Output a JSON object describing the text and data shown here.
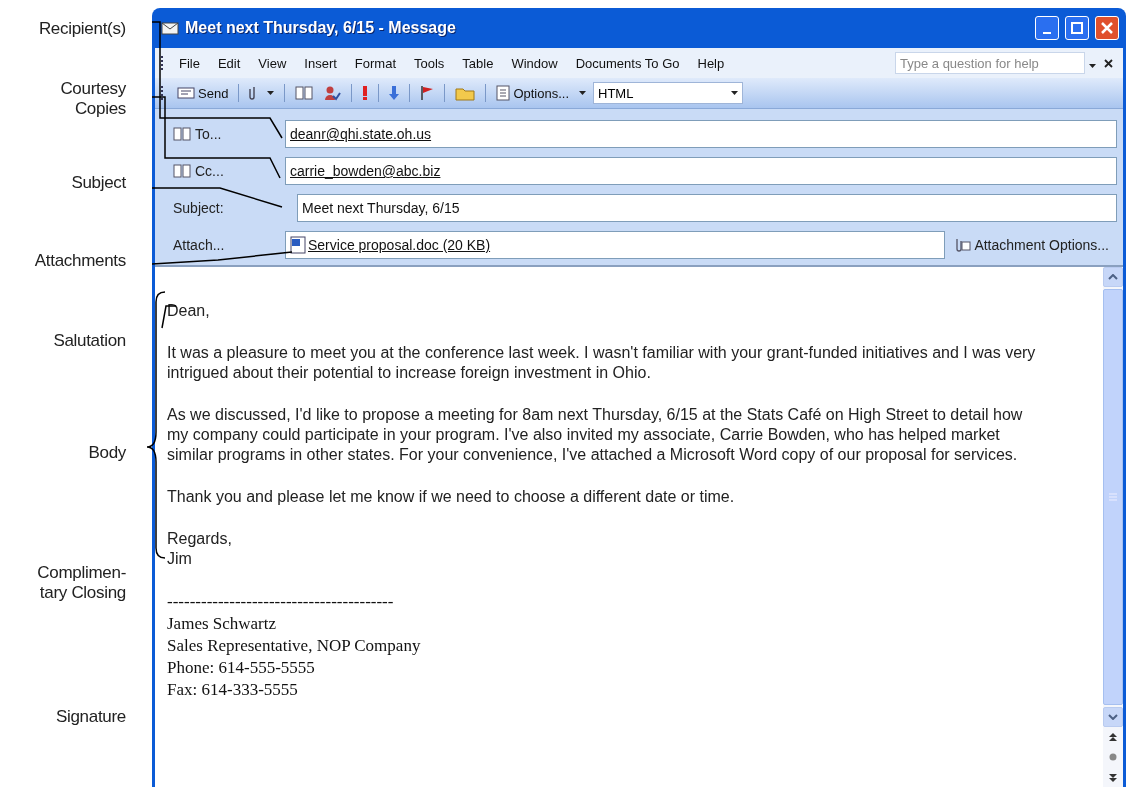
{
  "annotations": [
    {
      "kind": "line",
      "lines": [
        "Recipient(s)"
      ]
    },
    {
      "kind": "line",
      "lines": [
        "Courtesy",
        "Copies"
      ]
    },
    {
      "kind": "line",
      "lines": [
        "Subject"
      ]
    },
    {
      "kind": "line",
      "lines": [
        "Attachments"
      ]
    },
    {
      "kind": "line",
      "lines": [
        "Salutation"
      ]
    },
    {
      "kind": "brace",
      "lines": [
        "Body"
      ]
    },
    {
      "kind": "none",
      "lines": [
        "Complimen-",
        "tary Closing"
      ]
    },
    {
      "kind": "none",
      "lines": [
        "Signature"
      ]
    }
  ],
  "window": {
    "title": "Meet next Thursday, 6/15 - Message"
  },
  "menu": [
    "File",
    "Edit",
    "View",
    "Insert",
    "Format",
    "Tools",
    "Table",
    "Window",
    "Documents To Go",
    "Help"
  ],
  "help_box": {
    "placeholder": "Type a question for help"
  },
  "toolbar": {
    "send": "Send",
    "options": "Options...",
    "format": "HTML"
  },
  "fields": [
    {
      "kind": "address",
      "label": "To...",
      "value": "deanr@qhi.state.oh.us"
    },
    {
      "kind": "address",
      "label": "Cc...",
      "value": "carrie_bowden@abc.biz"
    },
    {
      "kind": "plain",
      "label": "Subject:",
      "value": "Meet next Thursday, 6/15"
    }
  ],
  "attachment": {
    "label": "Attach...",
    "file": "Service proposal.doc (20 KB)",
    "options": "Attachment Options..."
  },
  "body": {
    "salutation": "Dean,",
    "paragraphs": [
      "It was a pleasure to meet you at the conference last week. I wasn't familiar with your grant-funded initiatives and I was very intrigued about their potential to increase foreign investment in Ohio.",
      "As we discussed, I'd like to propose a meeting for 8am next Thursday, 6/15 at the Stats Café on High Street to detail how my company could participate in your program. I've also invited my associate, Carrie Bowden, who has helped market similar programs in other states. For your convenience, I've attached a Microsoft Word copy of our proposal for services.",
      "Thank you and please let me know if we need to choose a different date or time."
    ],
    "closing": [
      "Regards,",
      "Jim"
    ],
    "signature": [
      "----------------------------------------",
      "James Schwartz",
      "Sales Representative, NOP Company",
      "Phone: 614-555-5555",
      "Fax: 614-333-5555"
    ]
  }
}
